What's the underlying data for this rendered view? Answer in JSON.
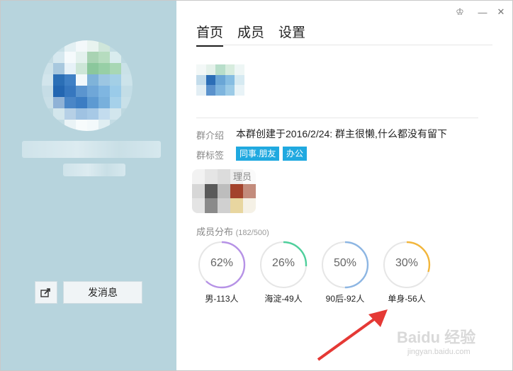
{
  "tabs": [
    {
      "label": "首页"
    },
    {
      "label": "成员"
    },
    {
      "label": "设置"
    }
  ],
  "left_panel": {
    "send_message_label": "发消息",
    "share_icon": "share-icon"
  },
  "window_controls": {
    "icons": [
      "skin-icon",
      "minimize-icon",
      "close-icon"
    ],
    "minimize_glyph": "—",
    "close_glyph": "✕",
    "skin_glyph": "♔"
  },
  "group_info": {
    "intro_label": "群介绍",
    "intro_text": "本群创建于2016/2/24: 群主很懒,什么都没有留下",
    "tags_label": "群标签",
    "tags": [
      "同事.朋友",
      "办公"
    ],
    "admin_label": "理员"
  },
  "distribution": {
    "title": "成员分布",
    "count": "(182/500)",
    "rings": [
      {
        "pct": "62%",
        "value": 0.62,
        "label": "男-113人",
        "color": "#b692e6"
      },
      {
        "pct": "26%",
        "value": 0.26,
        "label": "海淀-49人",
        "color": "#4fcf9c"
      },
      {
        "pct": "50%",
        "value": 0.5,
        "label": "90后-92人",
        "color": "#8db6e3"
      },
      {
        "pct": "30%",
        "value": 0.3,
        "label": "单身-56人",
        "color": "#f2b63c"
      }
    ]
  },
  "watermark": {
    "main": "Baidu 经验",
    "sub": "jingyan.baidu.com"
  },
  "colors": {
    "left_bg": "#b7d4dd",
    "tag_bg": "#20a9e0",
    "arrow": "#e53935"
  }
}
